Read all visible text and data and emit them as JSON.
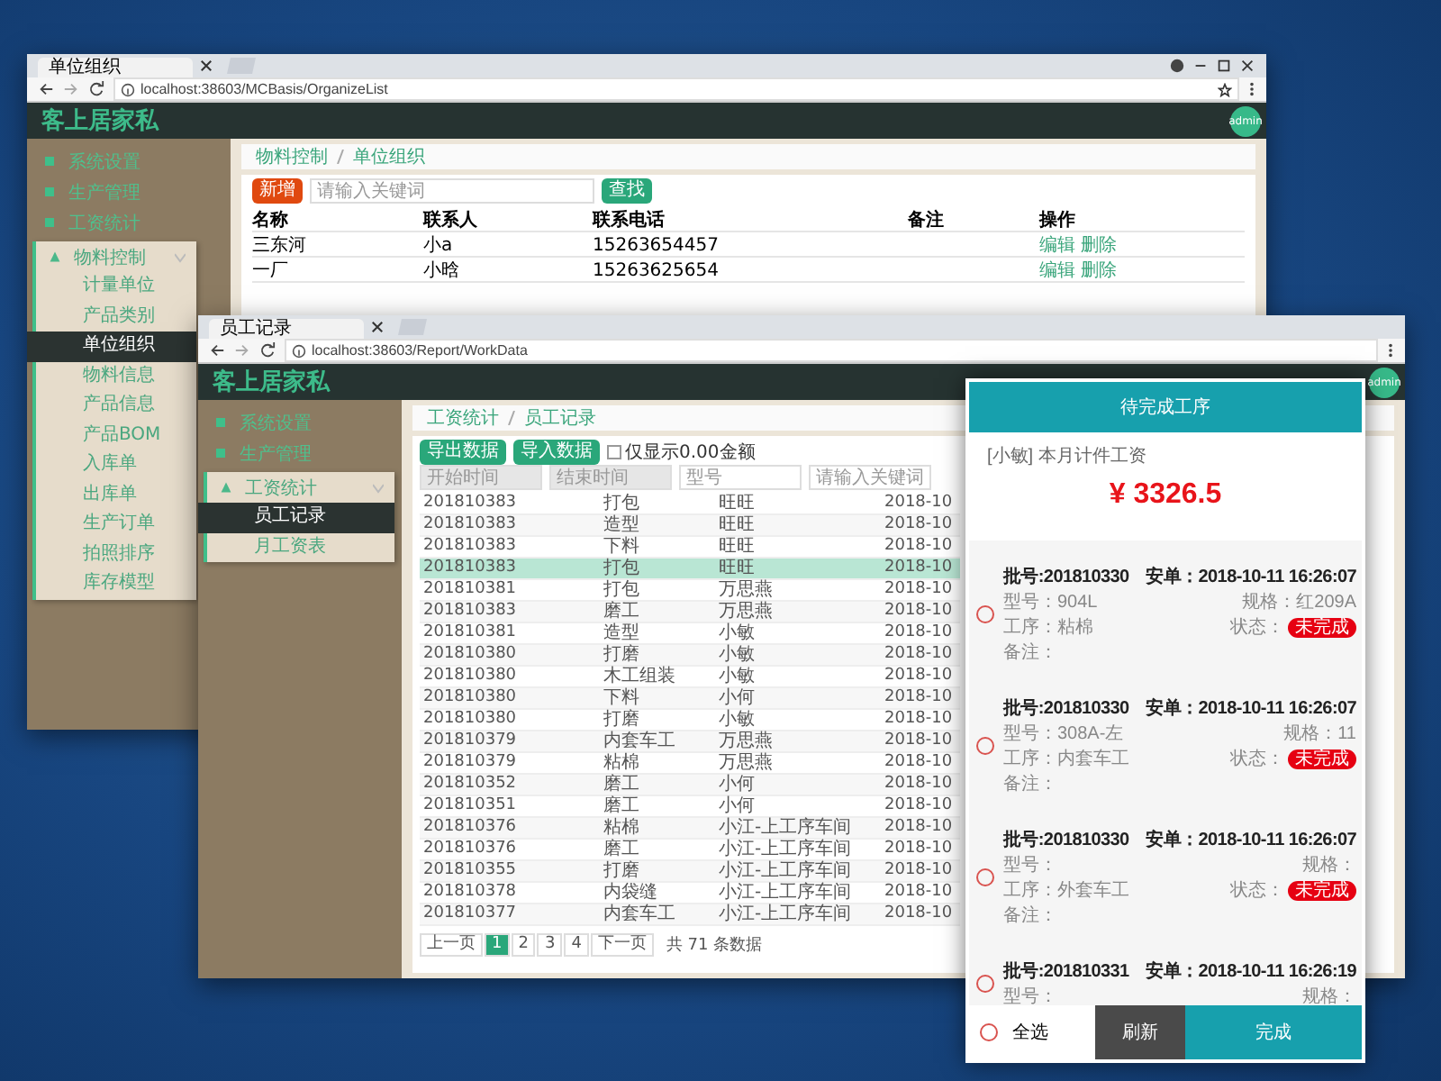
{
  "back_window": {
    "tab_title": "单位组织",
    "url": "localhost:38603/MCBasis/OrganizeList",
    "brand": "客上居家私",
    "avatar": "admin",
    "sidebar": [
      {
        "label": "系统设置",
        "selected": false
      },
      {
        "label": "生产管理",
        "selected": false
      },
      {
        "label": "工资统计",
        "selected": false
      },
      {
        "label": "物料控制",
        "expanded": true,
        "children": [
          {
            "label": "计量单位",
            "selected": false
          },
          {
            "label": "产品类别",
            "selected": false
          },
          {
            "label": "单位组织",
            "selected": true
          },
          {
            "label": "物料信息",
            "selected": false
          },
          {
            "label": "产品信息",
            "selected": false
          },
          {
            "label": "产品BOM",
            "selected": false
          },
          {
            "label": "入库单",
            "selected": false
          },
          {
            "label": "出库单",
            "selected": false
          },
          {
            "label": "生产订单",
            "selected": false
          },
          {
            "label": "拍照排序",
            "selected": false
          },
          {
            "label": "库存模型",
            "selected": false
          }
        ]
      }
    ],
    "breadcrumb": [
      "物料控制",
      "单位组织"
    ],
    "add_button": "新增",
    "search": {
      "placeholder": "请输入关键词"
    },
    "search_button": "查找",
    "table": {
      "columns": [
        "名称",
        "联系人",
        "联系电话",
        "备注",
        "操作"
      ],
      "rows": [
        {
          "cells": [
            "三东河",
            "小a",
            "15263654457"
          ],
          "actions": [
            "编辑",
            "删除"
          ]
        },
        {
          "cells": [
            "一厂",
            "小晗",
            "15263625654"
          ],
          "actions": [
            "编辑",
            "删除"
          ]
        }
      ]
    }
  },
  "front_window": {
    "tab_title": "员工记录",
    "url": "localhost:38603/Report/WorkData",
    "brand": "客上居家私",
    "avatar": "admin",
    "sidebar": [
      {
        "label": "系统设置",
        "selected": false
      },
      {
        "label": "生产管理",
        "selected": false
      },
      {
        "label": "工资统计",
        "expanded": true,
        "children": [
          {
            "label": "员工记录",
            "selected": true
          },
          {
            "label": "月工资表",
            "selected": false
          }
        ]
      }
    ],
    "breadcrumb": [
      "工资统计",
      "员工记录"
    ],
    "buttons": [
      "导出数据",
      "导入数据"
    ],
    "filter": {
      "label": "仅显示0.00金额",
      "checked": false
    },
    "fields": [
      {
        "placeholder": "开始时间",
        "disabled": true
      },
      {
        "placeholder": "结束时间",
        "disabled": true
      },
      {
        "placeholder": "型号",
        "disabled": false
      },
      {
        "placeholder": "请输入关键词",
        "disabled": false
      }
    ],
    "table": {
      "rows": [
        {
          "cells": [
            "201810383",
            "打包",
            "旺旺",
            "2018-10"
          ],
          "selected": false
        },
        {
          "cells": [
            "201810383",
            "造型",
            "旺旺",
            "2018-10"
          ],
          "selected": false
        },
        {
          "cells": [
            "201810383",
            "下料",
            "旺旺",
            "2018-10"
          ],
          "selected": false
        },
        {
          "cells": [
            "201810383",
            "打包",
            "旺旺",
            "2018-10"
          ],
          "selected": true
        },
        {
          "cells": [
            "201810381",
            "打包",
            "万思燕",
            "2018-10"
          ],
          "selected": false
        },
        {
          "cells": [
            "201810383",
            "磨工",
            "万思燕",
            "2018-10"
          ],
          "selected": false
        },
        {
          "cells": [
            "201810381",
            "造型",
            "小敏",
            "2018-10"
          ],
          "selected": false
        },
        {
          "cells": [
            "201810380",
            "打磨",
            "小敏",
            "2018-10"
          ],
          "selected": false
        },
        {
          "cells": [
            "201810380",
            "木工组装",
            "小敏",
            "2018-10"
          ],
          "selected": false
        },
        {
          "cells": [
            "201810380",
            "下料",
            "小何",
            "2018-10"
          ],
          "selected": false
        },
        {
          "cells": [
            "201810380",
            "打磨",
            "小敏",
            "2018-10"
          ],
          "selected": false
        },
        {
          "cells": [
            "201810379",
            "内套车工",
            "万思燕",
            "2018-10"
          ],
          "selected": false
        },
        {
          "cells": [
            "201810379",
            "粘棉",
            "万思燕",
            "2018-10"
          ],
          "selected": false
        },
        {
          "cells": [
            "201810352",
            "磨工",
            "小何",
            "2018-10"
          ],
          "selected": false
        },
        {
          "cells": [
            "201810351",
            "磨工",
            "小何",
            "2018-10"
          ],
          "selected": false
        },
        {
          "cells": [
            "201810376",
            "粘棉",
            "小江-上工序车间",
            "2018-10"
          ],
          "selected": false
        },
        {
          "cells": [
            "201810376",
            "磨工",
            "小江-上工序车间",
            "2018-10"
          ],
          "selected": false
        },
        {
          "cells": [
            "201810355",
            "打磨",
            "小江-上工序车间",
            "2018-10"
          ],
          "selected": false
        },
        {
          "cells": [
            "201810378",
            "内袋缝",
            "小江-上工序车间",
            "2018-10"
          ],
          "selected": false
        },
        {
          "cells": [
            "201810377",
            "内套车工",
            "小江-上工序车间",
            "2018-10"
          ],
          "selected": false
        }
      ]
    },
    "pagination": {
      "prev": "上一页",
      "pages": [
        {
          "label": "1",
          "selected": true
        },
        {
          "label": "2",
          "selected": false
        },
        {
          "label": "3",
          "selected": false
        },
        {
          "label": "4",
          "selected": false
        }
      ],
      "next": "下一页",
      "total": "共 71 条数据"
    }
  },
  "mobile_panel": {
    "title": "待完成工序",
    "salary_label": "[小敏] 本月计件工资",
    "amount": "¥ 3326.5",
    "cards": [
      {
        "batch": "批号:201810330",
        "time": "安单：2018-10-11 16:26:07",
        "model": "型号：904L",
        "spec": "规格：红209A",
        "process": "工序：粘棉",
        "status_label": "状态：",
        "status": "未完成",
        "note": "备注：",
        "selected": false
      },
      {
        "batch": "批号:201810330",
        "time": "安单：2018-10-11 16:26:07",
        "model": "型号：308A-左",
        "spec": "规格：11",
        "process": "工序：内套车工",
        "status_label": "状态：",
        "status": "未完成",
        "note": "备注：",
        "selected": false
      },
      {
        "batch": "批号:201810330",
        "time": "安单：2018-10-11 16:26:07",
        "model": "型号：",
        "spec": "规格：",
        "process": "工序：外套车工",
        "status_label": "状态：",
        "status": "未完成",
        "note": "备注：",
        "selected": false
      },
      {
        "batch": "批号:201810331",
        "time": "安单：2018-10-11 16:26:19",
        "model": "型号：",
        "spec": "规格：",
        "selected": false
      }
    ],
    "select_all": {
      "label": "全选",
      "checked": false
    },
    "refresh_button": "刷新",
    "done_button": "完成"
  }
}
